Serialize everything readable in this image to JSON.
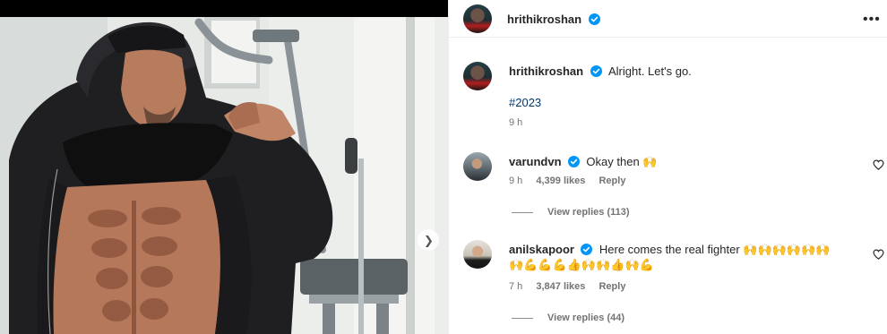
{
  "post": {
    "author": "hrithikroshan",
    "caption": "Alright. Let's go.",
    "hashtag": "#2023",
    "time": "9 h"
  },
  "icons": {
    "more": "more-options-icon",
    "verified": "verified-badge-icon",
    "heart": "heart-outline-icon",
    "next": "chevron-right-icon"
  },
  "colors": {
    "verified": "#0095f6",
    "hashtag": "#00376b",
    "muted": "#737373"
  },
  "comments": [
    {
      "username": "varundvn",
      "text": "Okay then 🙌",
      "time": "9 h",
      "likes": "4,399 likes",
      "reply": "Reply",
      "view_replies": "View replies (113)"
    },
    {
      "username": "anilskapoor",
      "text": "Here comes the real fighter 🙌🙌🙌🙌🙌🙌",
      "text_line2": "🙌💪💪💪👍🙌🙌👍🙌💪",
      "time": "7 h",
      "likes": "3,847 likes",
      "reply": "Reply",
      "view_replies": "View replies (44)"
    }
  ]
}
